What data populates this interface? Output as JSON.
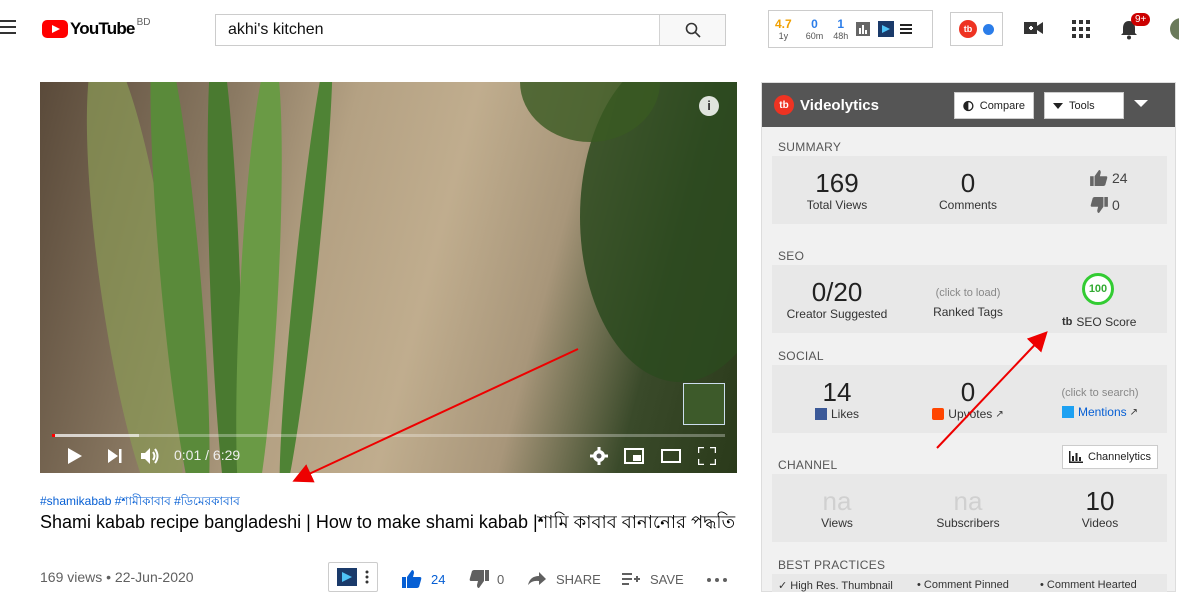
{
  "header": {
    "logo_text": "YouTube",
    "logo_country": "BD",
    "search_value": "akhi's kitchen",
    "ext_stats": [
      {
        "value": "4.7",
        "label": "1y",
        "color": "#f0a000"
      },
      {
        "value": "0",
        "label": "60m",
        "color": "#2b7de9"
      },
      {
        "value": "1",
        "label": "48h",
        "color": "#2b7de9"
      }
    ],
    "notifications_badge": "9+",
    "tb_logo": "tb"
  },
  "video": {
    "time": "0:01 / 6:29",
    "progress": 0.003,
    "info_glyph": "i"
  },
  "hashtags": "#shamikabab #শামীকাবাব #ডিমেরকাবাব",
  "title": "Shami kabab recipe bangladeshi | How to make shami kabab |শামি কাবাব বানানোর পদ্ধতি",
  "meta": "169 views • 22-Jun-2020",
  "actions": {
    "likes": "24",
    "dislikes": "0",
    "share": "SHARE",
    "save": "SAVE"
  },
  "panel": {
    "title": "Videolytics",
    "logo": "tb",
    "compare": "Compare",
    "tools": "Tools",
    "summary": {
      "label": "SUMMARY",
      "views": "169",
      "views_label": "Total Views",
      "comments": "0",
      "comments_label": "Comments",
      "likes": "24",
      "dislikes": "0"
    },
    "seo": {
      "label": "SEO",
      "creator": "0/20",
      "creator_label": "Creator Suggested",
      "click_load": "(click to load)",
      "ranked_tags": "Ranked Tags",
      "score": "100",
      "score_label": "SEO Score"
    },
    "social": {
      "label": "SOCIAL",
      "likes": "14",
      "likes_label": "Likes",
      "upvotes": "0",
      "upvotes_label": "Upvotes",
      "click_search": "(click to search)",
      "mentions_label": "Mentions"
    },
    "channel": {
      "label": "CHANNEL",
      "button": "Channelytics",
      "views": "na",
      "views_label": "Views",
      "subs": "na",
      "subs_label": "Subscribers",
      "videos": "10",
      "videos_label": "Videos"
    },
    "best_practices": {
      "label": "BEST PRACTICES",
      "items": [
        "High Res. Thumbnail",
        "Comment Pinned",
        "Comment Hearted"
      ]
    }
  }
}
